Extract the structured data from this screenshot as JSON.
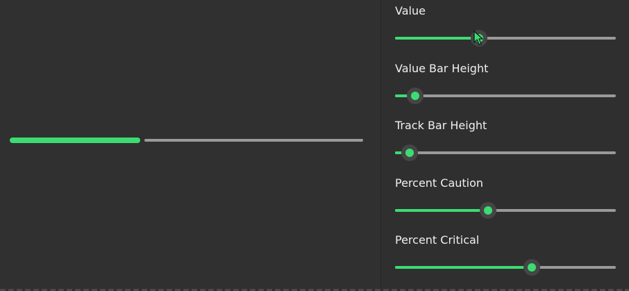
{
  "preview": {
    "value_fraction": 0.37,
    "value_color": "#3ddc73",
    "track_color": "#9a9a9a"
  },
  "controls": [
    {
      "label": "Value",
      "value_fraction": 0.38
    },
    {
      "label": "Value Bar Height",
      "value_fraction": 0.09
    },
    {
      "label": "Track Bar Height",
      "value_fraction": 0.065
    },
    {
      "label": "Percent Caution",
      "value_fraction": 0.42
    },
    {
      "label": "Percent Critical",
      "value_fraction": 0.62
    }
  ],
  "colors": {
    "accent": "#3ddc73",
    "background": "#2f2f2f",
    "track": "#9a9a9a"
  },
  "icons": {
    "cursor": "mouse-pointer-icon"
  }
}
